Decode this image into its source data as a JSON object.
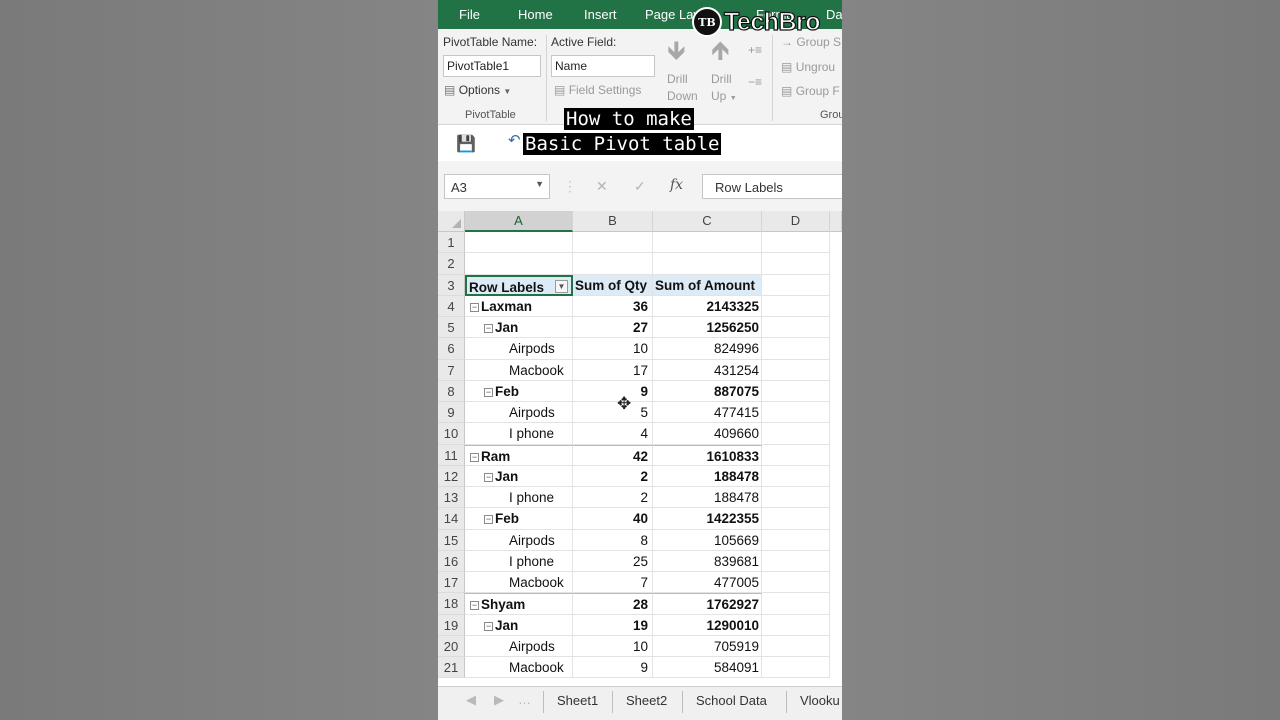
{
  "ribbon": {
    "tabs": [
      "File",
      "Home",
      "Insert",
      "Page Lay",
      "Forma",
      "Da"
    ],
    "pivot_name_label": "PivotTable Name:",
    "pivot_name_value": "PivotTable1",
    "active_field_label": "Active Field:",
    "active_field_value": "Name",
    "options_label": "Options",
    "field_settings_label": "Field Settings",
    "drill_down_label": [
      "Drill",
      "Down"
    ],
    "drill_up_label": [
      "Drill",
      "Up"
    ],
    "group_selection": "Group S",
    "ungroup": "Ungrou",
    "group_field": "Group F",
    "pivottable_group": "PivotTable",
    "group_group": "Grou"
  },
  "caption": [
    "How to make",
    "Basic Pivot table"
  ],
  "logo": {
    "mark": "TB",
    "text": "TechBro"
  },
  "formula_bar": {
    "name_box": "A3",
    "fx": "fx",
    "value": "Row Labels"
  },
  "columns": [
    "A",
    "B",
    "C",
    "D"
  ],
  "header": {
    "row_labels": "Row Labels",
    "sum_qty": "Sum of Qty",
    "sum_amount": "Sum of Amount"
  },
  "rows": [
    {
      "n": "1",
      "label": "",
      "qty": "",
      "amount": "",
      "level": -1,
      "bold": false
    },
    {
      "n": "2",
      "label": "",
      "qty": "",
      "amount": "",
      "level": -1,
      "bold": false
    },
    {
      "n": "3",
      "label": "",
      "qty": "",
      "amount": "",
      "level": -2,
      "bold": true
    },
    {
      "n": "4",
      "label": "Laxman",
      "qty": "36",
      "amount": "2143325",
      "level": 0,
      "bold": true
    },
    {
      "n": "5",
      "label": "Jan",
      "qty": "27",
      "amount": "1256250",
      "level": 1,
      "bold": true
    },
    {
      "n": "6",
      "label": "Airpods",
      "qty": "10",
      "amount": "824996",
      "level": 2,
      "bold": false
    },
    {
      "n": "7",
      "label": "Macbook",
      "qty": "17",
      "amount": "431254",
      "level": 2,
      "bold": false
    },
    {
      "n": "8",
      "label": "Feb",
      "qty": "9",
      "amount": "887075",
      "level": 1,
      "bold": true
    },
    {
      "n": "9",
      "label": "Airpods",
      "qty": "5",
      "amount": "477415",
      "level": 2,
      "bold": false
    },
    {
      "n": "10",
      "label": "I phone",
      "qty": "4",
      "amount": "409660",
      "level": 2,
      "bold": false
    },
    {
      "n": "11",
      "label": "Ram",
      "qty": "42",
      "amount": "1610833",
      "level": 0,
      "bold": true
    },
    {
      "n": "12",
      "label": "Jan",
      "qty": "2",
      "amount": "188478",
      "level": 1,
      "bold": true
    },
    {
      "n": "13",
      "label": "I phone",
      "qty": "2",
      "amount": "188478",
      "level": 2,
      "bold": false
    },
    {
      "n": "14",
      "label": "Feb",
      "qty": "40",
      "amount": "1422355",
      "level": 1,
      "bold": true
    },
    {
      "n": "15",
      "label": "Airpods",
      "qty": "8",
      "amount": "105669",
      "level": 2,
      "bold": false
    },
    {
      "n": "16",
      "label": "I phone",
      "qty": "25",
      "amount": "839681",
      "level": 2,
      "bold": false
    },
    {
      "n": "17",
      "label": "Macbook",
      "qty": "7",
      "amount": "477005",
      "level": 2,
      "bold": false
    },
    {
      "n": "18",
      "label": "Shyam",
      "qty": "28",
      "amount": "1762927",
      "level": 0,
      "bold": true
    },
    {
      "n": "19",
      "label": "Jan",
      "qty": "19",
      "amount": "1290010",
      "level": 1,
      "bold": true
    },
    {
      "n": "20",
      "label": "Airpods",
      "qty": "10",
      "amount": "705919",
      "level": 2,
      "bold": false
    },
    {
      "n": "21",
      "label": "Macbook",
      "qty": "9",
      "amount": "584091",
      "level": 2,
      "bold": false
    }
  ],
  "sheets": [
    "Sheet1",
    "Sheet2",
    "School Data",
    "Vlooku"
  ],
  "colors": {
    "excel_green": "#217346",
    "pivot_header": "#ddebf7"
  }
}
